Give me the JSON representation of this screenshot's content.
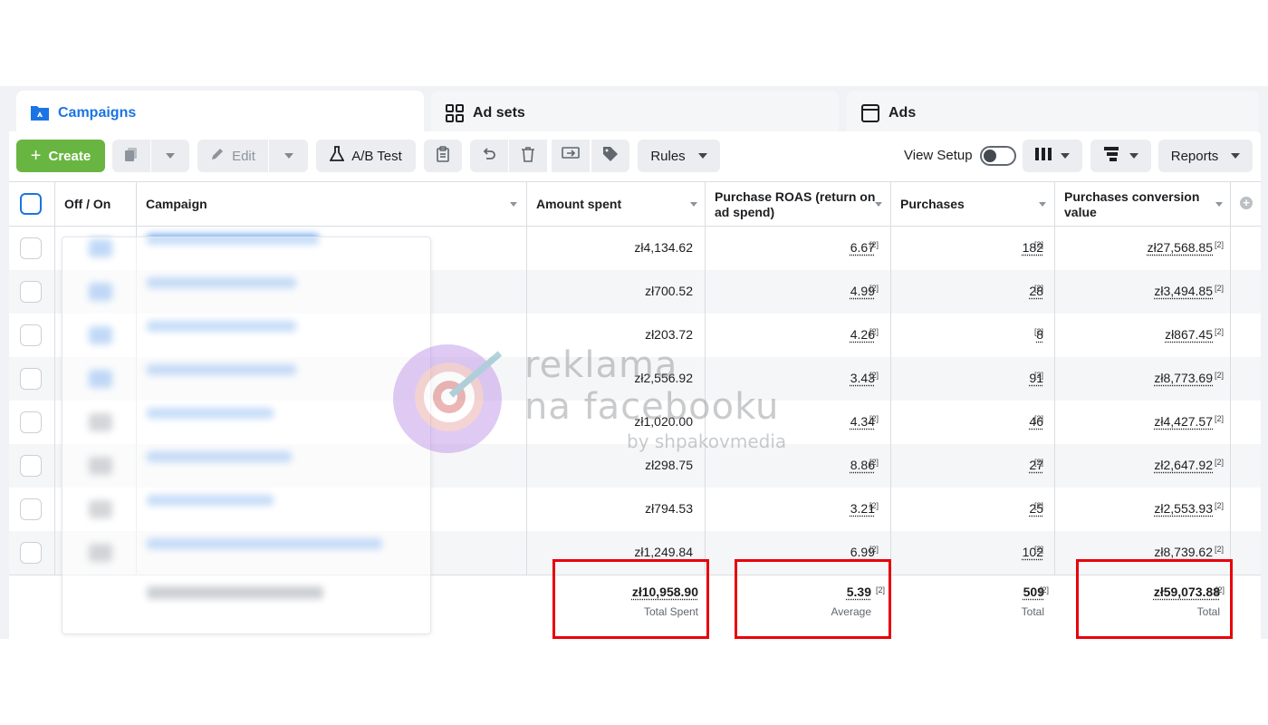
{
  "tabs": [
    {
      "label": "Campaigns",
      "icon": "campaigns-folder-icon",
      "active": true
    },
    {
      "label": "Ad sets",
      "icon": "grid-icon",
      "active": false
    },
    {
      "label": "Ads",
      "icon": "ad-window-icon",
      "active": false
    }
  ],
  "toolbar": {
    "create_label": "Create",
    "edit_label": "Edit",
    "ab_test_label": "A/B Test",
    "rules_label": "Rules",
    "view_setup_label": "View Setup",
    "reports_label": "Reports"
  },
  "columns": {
    "off_on": "Off / On",
    "campaign": "Campaign",
    "amount_spent": "Amount spent",
    "roas": "Purchase ROAS (return on ad spend)",
    "purchases": "Purchases",
    "conversion_value": "Purchases conversion value"
  },
  "footnote_marker": "[2]",
  "rows": [
    {
      "spent": "zł4,134.62",
      "roas": "6.67",
      "purchases": "182",
      "value": "zł27,568.85"
    },
    {
      "spent": "zł700.52",
      "roas": "4.99",
      "purchases": "28",
      "value": "zł3,494.85"
    },
    {
      "spent": "zł203.72",
      "roas": "4.26",
      "purchases": "8",
      "value": "zł867.45"
    },
    {
      "spent": "zł2,556.92",
      "roas": "3.43",
      "purchases": "91",
      "value": "zł8,773.69"
    },
    {
      "spent": "zł1,020.00",
      "roas": "4.34",
      "purchases": "46",
      "value": "zł4,427.57"
    },
    {
      "spent": "zł298.75",
      "roas": "8.86",
      "purchases": "27",
      "value": "zł2,647.92"
    },
    {
      "spent": "zł794.53",
      "roas": "3.21",
      "purchases": "25",
      "value": "zł2,553.93"
    },
    {
      "spent": "zł1,249.84",
      "roas": "6.99",
      "purchases": "102",
      "value": "zł8,739.62"
    }
  ],
  "totals": {
    "spent": "zł10,958.90",
    "spent_label": "Total Spent",
    "roas": "5.39",
    "roas_label": "Average",
    "purchases": "509",
    "purchases_label": "Total",
    "value": "zł59,073.88",
    "value_label": "Total"
  },
  "watermark": {
    "line1": "reklama",
    "line2": "na facebooku",
    "line3": "by shpakovmedia"
  },
  "colors": {
    "accent": "#1b74e4",
    "create_green": "#68b641",
    "highlight_red": "#e8000b"
  }
}
